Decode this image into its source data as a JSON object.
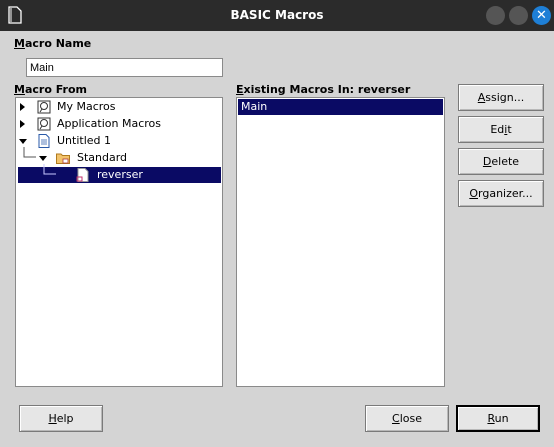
{
  "window": {
    "title": "BASIC Macros"
  },
  "macro_name": {
    "label_prefix": "M",
    "label_rest": "acro Name",
    "value": "Main"
  },
  "macro_from": {
    "label_prefix": "M",
    "label_rest": "acro From",
    "items": [
      {
        "label": "My Macros",
        "icon": "macro-library-icon",
        "expander": "collapsed"
      },
      {
        "label": "Application Macros",
        "icon": "macro-library-icon",
        "expander": "collapsed"
      },
      {
        "label": "Untitled 1",
        "icon": "document-icon",
        "expander": "expanded"
      },
      {
        "label": "Standard",
        "icon": "folder-icon",
        "expander": "expanded"
      },
      {
        "label": "reverser",
        "icon": "module-icon",
        "selected": true
      }
    ]
  },
  "existing": {
    "label_prefix": "E",
    "label_rest": "xisting Macros In: reverser",
    "items": [
      "Main"
    ]
  },
  "buttons": {
    "assign": {
      "pre": "",
      "u": "A",
      "post": "ssign..."
    },
    "edit": {
      "pre": "Ed",
      "u": "i",
      "post": "t"
    },
    "delete": {
      "pre": "",
      "u": "D",
      "post": "elete"
    },
    "organizer": {
      "pre": "",
      "u": "O",
      "post": "rganizer..."
    },
    "help": {
      "pre": "",
      "u": "H",
      "post": "elp"
    },
    "close": {
      "pre": "",
      "u": "C",
      "post": "lose"
    },
    "run": {
      "pre": "",
      "u": "R",
      "post": "un"
    }
  },
  "colors": {
    "selection": "#0a0a64",
    "titlebar": "#2b2b2b",
    "close_button": "#1e7fd6"
  }
}
